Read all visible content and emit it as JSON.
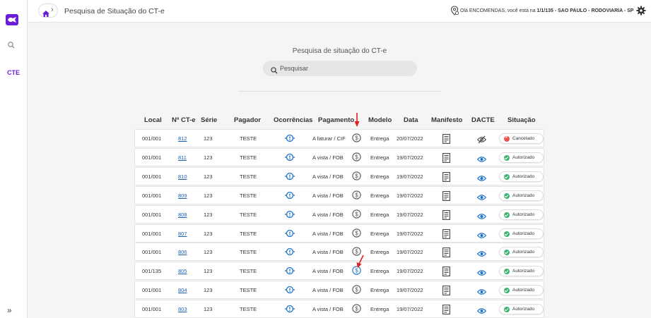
{
  "sidebar": {
    "cte_label": "CTE",
    "icons": [
      "app-logo-icon",
      "search-icon",
      "expand-icon"
    ],
    "expand_label": "»"
  },
  "header": {
    "breadcrumb_chevron": "›",
    "title": "Pesquisa de Situação do CT-e",
    "user_greeting": "Olá ENCOMENDAS, você está na ",
    "user_location": "1/1/135 - SAO PAULO - RODOVIARIA - SP"
  },
  "main": {
    "heading": "Pesquisa de situação do CT-e",
    "search_placeholder": "Pesquisar"
  },
  "table": {
    "columns": [
      "Local",
      "Nº CT-e",
      "Série",
      "Pagador",
      "Ocorrências",
      "Pagamento",
      "Modelo",
      "Data",
      "Manifesto",
      "DACTE",
      "Situação"
    ],
    "rows": [
      {
        "local": "001/001",
        "cte": "812",
        "serie": "123",
        "pagador": "TESTE",
        "pagamento": "A faturar / CIF",
        "modelo": "Entrega",
        "data": "20/07/2022",
        "situacao": "Cancelado",
        "status": "cancelado",
        "dacte_visible": false
      },
      {
        "local": "001/001",
        "cte": "811",
        "serie": "123",
        "pagador": "TESTE",
        "pagamento": "A vista / FOB",
        "modelo": "Entrega",
        "data": "19/07/2022",
        "situacao": "Autorizado",
        "status": "autorizado",
        "dacte_visible": true
      },
      {
        "local": "001/001",
        "cte": "810",
        "serie": "123",
        "pagador": "TESTE",
        "pagamento": "A vista / FOB",
        "modelo": "Entrega",
        "data": "19/07/2022",
        "situacao": "Autorizado",
        "status": "autorizado",
        "dacte_visible": true
      },
      {
        "local": "001/001",
        "cte": "809",
        "serie": "123",
        "pagador": "TESTE",
        "pagamento": "A vista / FOB",
        "modelo": "Entrega",
        "data": "19/07/2022",
        "situacao": "Autorizado",
        "status": "autorizado",
        "dacte_visible": true
      },
      {
        "local": "001/001",
        "cte": "808",
        "serie": "123",
        "pagador": "TESTE",
        "pagamento": "A vista / FOB",
        "modelo": "Entrega",
        "data": "19/07/2022",
        "situacao": "Autorizado",
        "status": "autorizado",
        "dacte_visible": true
      },
      {
        "local": "001/001",
        "cte": "807",
        "serie": "123",
        "pagador": "TESTE",
        "pagamento": "A vista / FOB",
        "modelo": "Entrega",
        "data": "19/07/2022",
        "situacao": "Autorizado",
        "status": "autorizado",
        "dacte_visible": true
      },
      {
        "local": "001/001",
        "cte": "806",
        "serie": "123",
        "pagador": "TESTE",
        "pagamento": "A vista / FOB",
        "modelo": "Entrega",
        "data": "19/07/2022",
        "situacao": "Autorizado",
        "status": "autorizado",
        "dacte_visible": true
      },
      {
        "local": "001/135",
        "cte": "805",
        "serie": "123",
        "pagador": "TESTE",
        "pagamento": "A vista / FOB",
        "modelo": "Entrega",
        "data": "19/07/2022",
        "situacao": "Autorizado",
        "status": "autorizado",
        "dacte_visible": true,
        "payment_highlighted": true
      },
      {
        "local": "001/001",
        "cte": "804",
        "serie": "123",
        "pagador": "TESTE",
        "pagamento": "A vista / FOB",
        "modelo": "Entrega",
        "data": "19/07/2022",
        "situacao": "Autorizado",
        "status": "autorizado",
        "dacte_visible": true
      },
      {
        "local": "001/001",
        "cte": "803",
        "serie": "123",
        "pagador": "TESTE",
        "pagamento": "A vista / FOB",
        "modelo": "Entrega",
        "data": "19/07/2022",
        "situacao": "Autorizado",
        "status": "autorizado",
        "dacte_visible": true
      }
    ]
  },
  "colors": {
    "brand": "#6a1fd6",
    "link": "#1a5fb4",
    "icon_blue": "#1a73c8",
    "success": "#3cb371",
    "danger": "#e8534a",
    "annotation_arrow": "#e02020"
  }
}
